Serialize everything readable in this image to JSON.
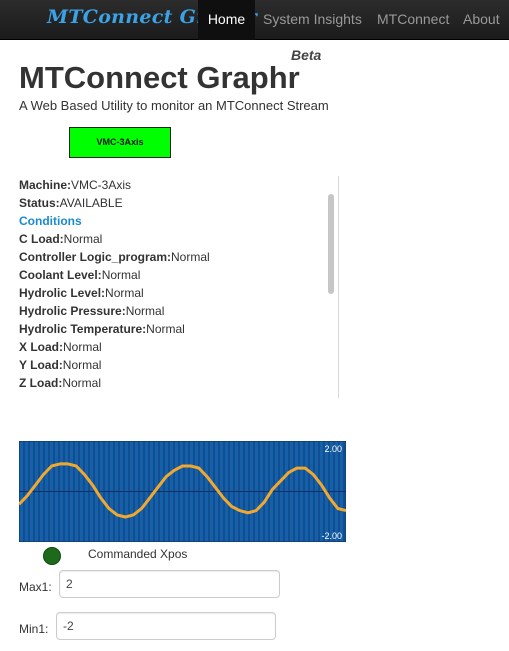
{
  "nav": {
    "brand": "MTConnect Graphr",
    "items": [
      "Home",
      "System Insights",
      "MTConnect",
      "About"
    ],
    "active": "Home"
  },
  "header": {
    "beta": "Beta",
    "title": "MTConnect Graphr",
    "subtitle": "A Web Based Utility to monitor an MTConnect Stream"
  },
  "machine_button": {
    "label": "VMC-3Axis",
    "color": "#00ff00"
  },
  "status": {
    "machine_label": "Machine:",
    "machine_value": "VMC-3Axis",
    "status_label": "Status:",
    "status_value": "AVAILABLE",
    "conditions_heading": "Conditions",
    "conditions": [
      {
        "name": "C Load:",
        "value": "Normal"
      },
      {
        "name": "Controller Logic_program:",
        "value": "Normal"
      },
      {
        "name": "Coolant Level:",
        "value": "Normal"
      },
      {
        "name": "Hydrolic Level:",
        "value": "Normal"
      },
      {
        "name": "Hydrolic Pressure:",
        "value": "Normal"
      },
      {
        "name": "Hydrolic Temperature:",
        "value": "Normal"
      },
      {
        "name": "X Load:",
        "value": "Normal"
      },
      {
        "name": "Y Load:",
        "value": "Normal"
      },
      {
        "name": "Z Load:",
        "value": "Normal"
      }
    ]
  },
  "chart_data": {
    "type": "line",
    "ylim": [
      -2,
      2
    ],
    "y_tick_labels": [
      "2.00",
      "-2.00"
    ],
    "series": [
      {
        "name": "Commanded Xpos",
        "color": "#f0a830",
        "values": [
          -0.6,
          -0.2,
          0.3,
          0.8,
          1.2,
          1.3,
          1.3,
          1.2,
          0.8,
          0.3,
          -0.3,
          -0.8,
          -1.1,
          -1.2,
          -1.1,
          -0.8,
          -0.3,
          0.2,
          0.7,
          1.0,
          1.2,
          1.2,
          1.1,
          0.7,
          0.2,
          -0.3,
          -0.7,
          -0.9,
          -1.0,
          -0.9,
          -0.5,
          0.1,
          0.5,
          0.9,
          1.1,
          1.1,
          0.8,
          0.3,
          -0.3,
          -0.8,
          -0.9
        ]
      }
    ],
    "background": "#1560a8",
    "grid": true
  },
  "controls": {
    "max_label": "Max1:",
    "max_value": "2",
    "min_label": "Min1:",
    "min_value": "-2"
  }
}
